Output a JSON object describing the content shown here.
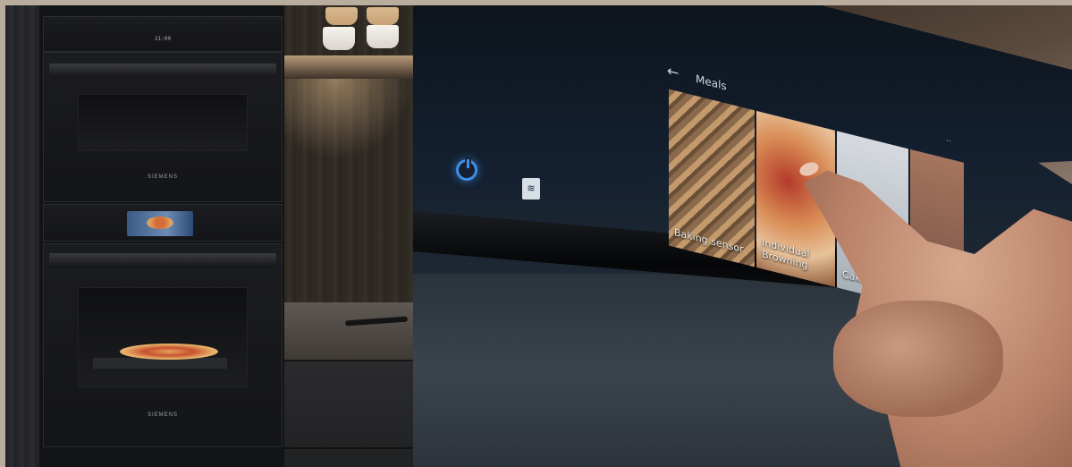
{
  "left_photo": {
    "brand_upper": "SIEMENS",
    "brand_lower": "SIEMENS",
    "clock": "21:00"
  },
  "right_photo": {
    "screen_title": "Meals",
    "meal_tiles": [
      {
        "label": "Baking sensor"
      },
      {
        "label": "Individual Browning"
      },
      {
        "label": "Cake"
      },
      {
        "label": ""
      }
    ],
    "icons": [
      "back-arrow-icon",
      "power-icon",
      "menu-icon"
    ],
    "accent_color": "#3f8fe8"
  }
}
